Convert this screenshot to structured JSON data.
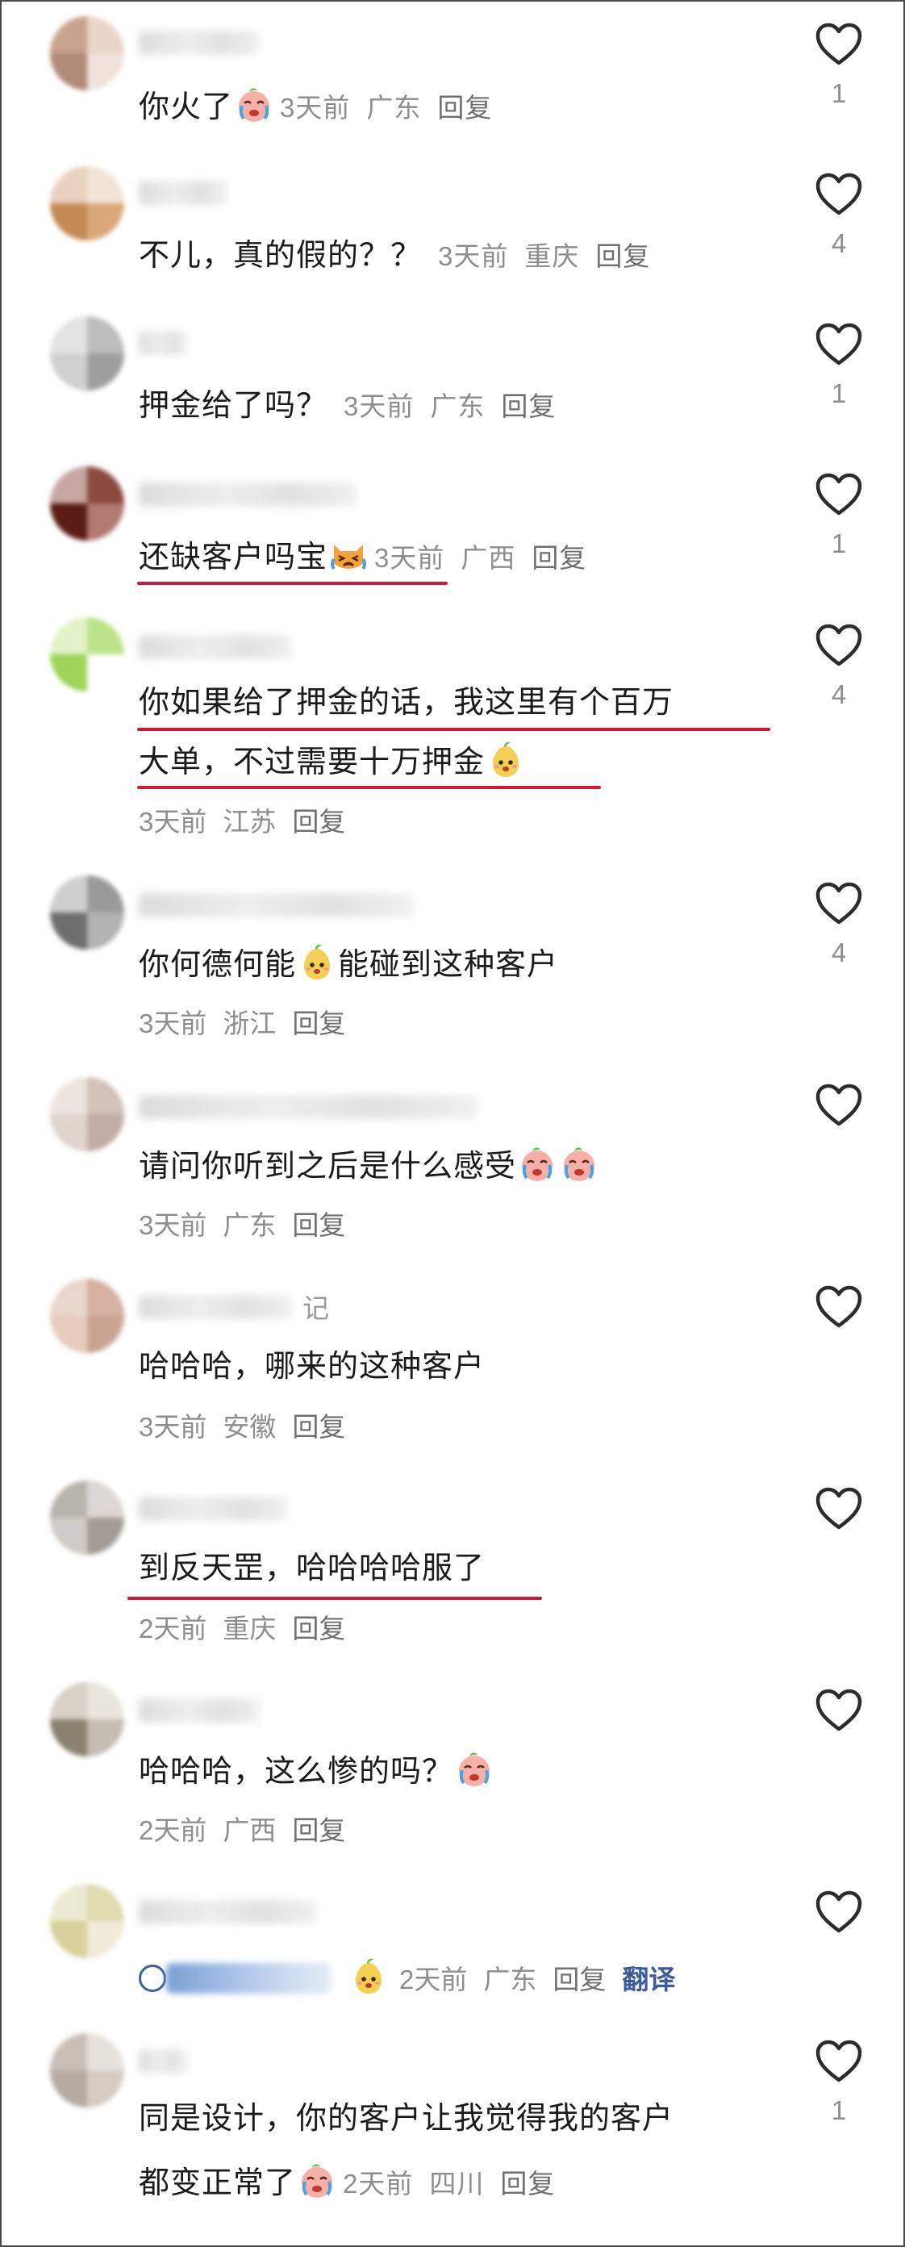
{
  "comments": [
    {
      "text1": "你火了",
      "time": "3天前",
      "loc": "广东",
      "reply": "回复",
      "likes": "1"
    },
    {
      "text1": "不儿，真的假的？？",
      "time": "3天前",
      "loc": "重庆",
      "reply": "回复",
      "likes": "4"
    },
    {
      "text1": "押金给了吗？",
      "time": "3天前",
      "loc": "广东",
      "reply": "回复",
      "likes": "1"
    },
    {
      "text1": "还缺客户吗宝",
      "time": "3天前",
      "loc": "广西",
      "reply": "回复",
      "likes": "1"
    },
    {
      "text1": "你如果给了押金的话，我这里有个百万",
      "text2": "大单，不过需要十万押金",
      "time": "3天前",
      "loc": "江苏",
      "reply": "回复",
      "likes": "4"
    },
    {
      "text1a": "你何德何能",
      "text1b": "能碰到这种客户",
      "time": "3天前",
      "loc": "浙江",
      "reply": "回复",
      "likes": "4"
    },
    {
      "text1": "请问你听到之后是什么感受",
      "time": "3天前",
      "loc": "广东",
      "reply": "回复",
      "likes": ""
    },
    {
      "name_tail": "记",
      "text1": "哈哈哈，哪来的这种客户",
      "time": "3天前",
      "loc": "安徽",
      "reply": "回复",
      "likes": ""
    },
    {
      "text1": "到反天罡，哈哈哈哈服了",
      "time": "2天前",
      "loc": "重庆",
      "reply": "回复",
      "likes": ""
    },
    {
      "text1": "哈哈哈，这么惨的吗？",
      "time": "2天前",
      "loc": "广西",
      "reply": "回复",
      "likes": ""
    },
    {
      "time": "2天前",
      "loc": "广东",
      "reply": "回复",
      "translate": "翻译",
      "likes": ""
    },
    {
      "text1": "同是设计，你的客户让我觉得我的客户",
      "text2": "都变正常了",
      "time": "2天前",
      "loc": "四川",
      "reply": "回复",
      "likes": "1"
    }
  ],
  "icons": {
    "like": "heart-outline-icon",
    "emoji_cry": "crying-face-emoji",
    "emoji_cat": "crying-cat-emoji",
    "emoji_pear": "pear-face-emoji"
  },
  "colors": {
    "underline": "#d11a3b",
    "meta": "#8e8e8e",
    "translate": "#3b5b9a"
  }
}
